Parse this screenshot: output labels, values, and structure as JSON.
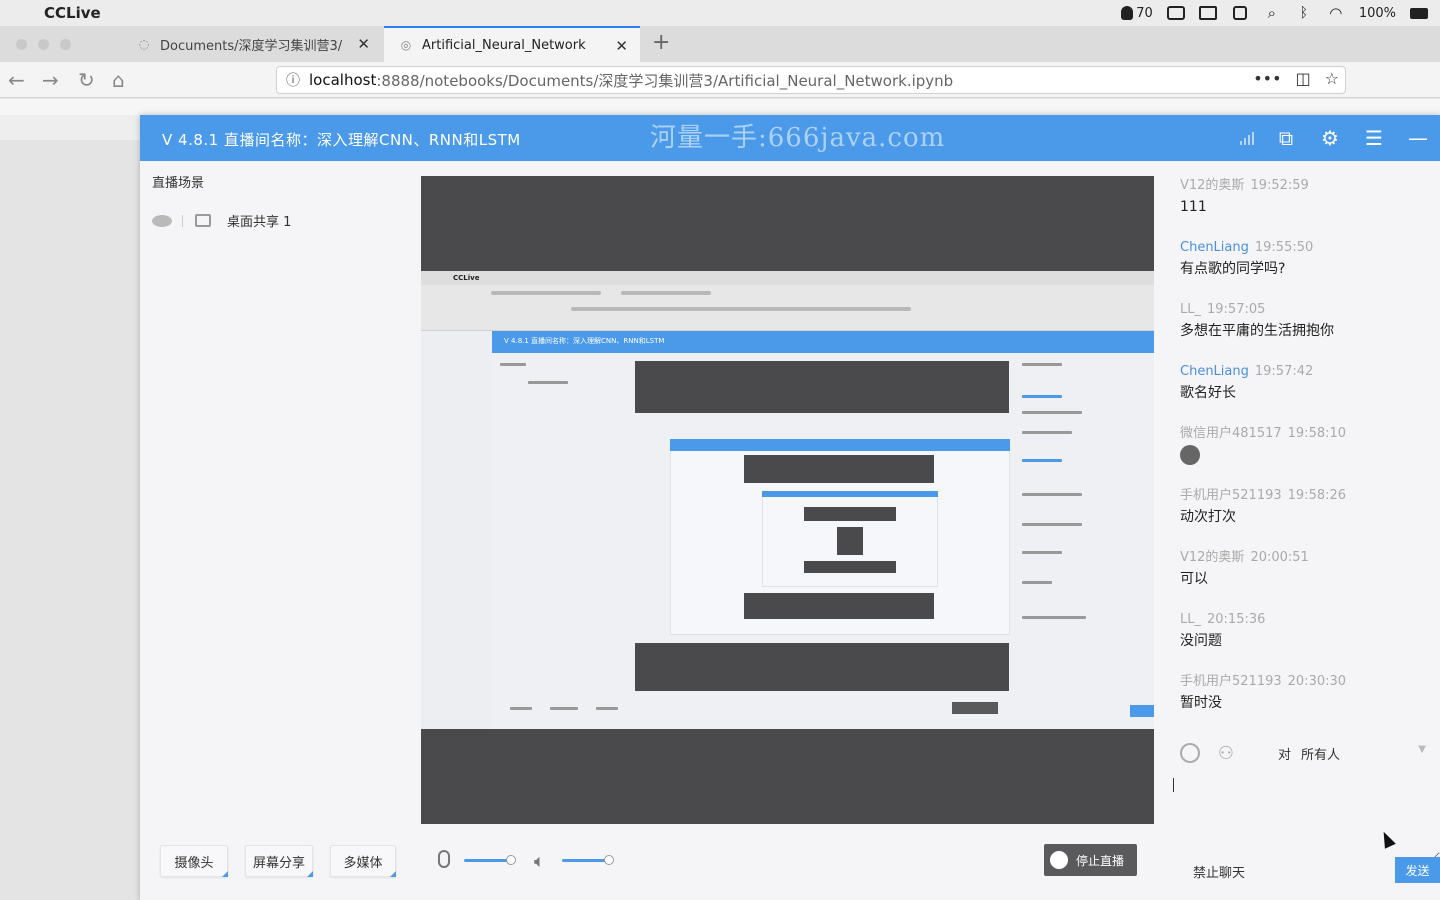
{
  "menubar": {
    "app_name": "CCLive",
    "battery_count": "70",
    "battery_pct": "100%"
  },
  "tabs": [
    {
      "label": "Documents/深度学习集训营3/",
      "close": "✕"
    },
    {
      "label": "Artificial_Neural_Network",
      "close": "✕"
    }
  ],
  "newtab": "+",
  "nav": {
    "url_host": "localhost",
    "url_path": ":8888/notebooks/Documents/深度学习集训营3/Artificial_Neural_Network.ipynb",
    "more": "•••"
  },
  "cclive": {
    "title": "V 4.8.1   直播间名称：深入理解CNN、RNN和LSTM",
    "watermark": "河量一手:666java.com",
    "scene_title": "直播场景",
    "scene_item": "桌面共享 1",
    "buttons": {
      "camera": "摄像头",
      "screen_share": "屏幕分享",
      "media": "多媒体",
      "stop_live": "停止直播"
    },
    "inner_preview": {
      "title": "V 4.8.1  直播间名称：深入理解CNN、RNN和LSTM",
      "menubar_app": "CCLive"
    }
  },
  "chat": {
    "messages": [
      {
        "user": "V12的奥斯",
        "time": "19:52:59",
        "text": "111",
        "highlight": false
      },
      {
        "user": "ChenLiang",
        "time": "19:55:50",
        "text": "有点歌的同学吗?",
        "highlight": true
      },
      {
        "user": "LL_",
        "time": "19:57:05",
        "text": "多想在平庸的生活拥抱你",
        "highlight": false
      },
      {
        "user": "ChenLiang",
        "time": "19:57:42",
        "text": "歌名好长",
        "highlight": true
      },
      {
        "user": "微信用户481517",
        "time": "19:58:10",
        "text": "",
        "highlight": false,
        "emoji": true
      },
      {
        "user": "手机用户521193",
        "time": "19:58:26",
        "text": "动次打次",
        "highlight": false
      },
      {
        "user": "V12的奥斯",
        "time": "20:00:51",
        "text": "可以",
        "highlight": false
      },
      {
        "user": "LL_",
        "time": "20:15:36",
        "text": "没问题",
        "highlight": false
      },
      {
        "user": "手机用户521193",
        "time": "20:30:30",
        "text": "暂时没",
        "highlight": false
      }
    ],
    "to_label": "对",
    "audience": "所有人",
    "ban_chat": "禁止聊天",
    "send": "发送"
  }
}
